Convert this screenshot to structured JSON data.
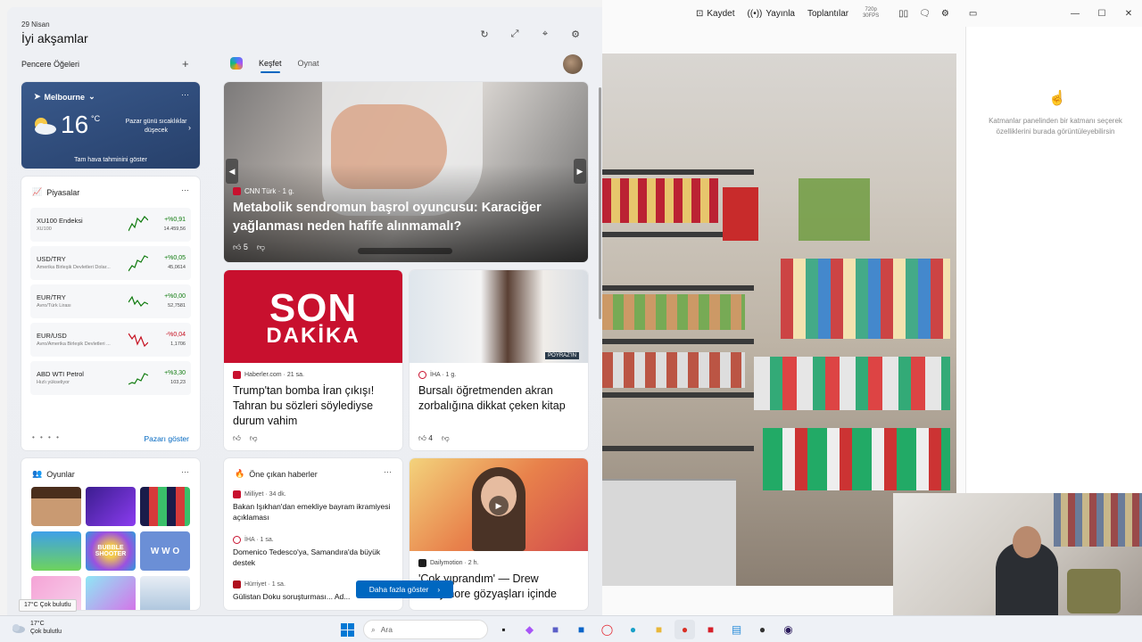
{
  "widgets": {
    "date": "29 Nisan",
    "greeting": "İyi akşamlar",
    "section_label": "Pencere Öğeleri",
    "tabs": [
      "Keşfet",
      "Oynat"
    ]
  },
  "weather": {
    "location": "Melbourne",
    "temperature": "16",
    "unit": "°C",
    "forecast": "Pazar günü sıcaklıklar düşecek",
    "full_link": "Tam hava tahminini göster"
  },
  "markets": {
    "title": "Piyasalar",
    "footer_link": "Pazarı göster",
    "rows": [
      {
        "symbol": "XU100 Endeksi",
        "sub": "XU100",
        "change": "+%0,91",
        "value": "14.459,56",
        "trend": "up"
      },
      {
        "symbol": "USD/TRY",
        "sub": "Amerika Birleşik Devletleri Dolar...",
        "change": "+%0,05",
        "value": "45,0614",
        "trend": "up"
      },
      {
        "symbol": "EUR/TRY",
        "sub": "Avro/Türk Lirası",
        "change": "+%0,00",
        "value": "52,7581",
        "trend": "up"
      },
      {
        "symbol": "EUR/USD",
        "sub": "Avro/Amerika Birleşik Devletleri ...",
        "change": "-%0,04",
        "value": "1,1706",
        "trend": "down"
      },
      {
        "symbol": "ABD WTI Petrol",
        "sub": "Hızlı yükseliyor",
        "change": "+%3,30",
        "value": "103,23",
        "trend": "up"
      }
    ]
  },
  "games": {
    "title": "Oyunlar",
    "tiles": [
      "BUBBLE SHOOTER",
      "W W O"
    ]
  },
  "hero": {
    "source": "CNN Türk · 1 g.",
    "headline": "Metabolik sendromun başrol oyuncusu: Karaciğer yağlanması neden hafife alınmamalı?",
    "likes": "5"
  },
  "news": [
    {
      "image_text_1": "SON",
      "image_text_2": "DAKİKA",
      "source": "Haberler.com · 21 sa.",
      "title": "Trump'tan bomba İran çıkışı! Tahran bu sözleri söylediyse durum vahim"
    },
    {
      "image_caption": "POYRAZ'IN",
      "source": "İHA · 1 g.",
      "title": "Bursalı öğretmenden akran zorbalığına dikkat çeken kitap",
      "likes": "4"
    }
  ],
  "featured": {
    "title": "Öne çıkan haberler",
    "items": [
      {
        "source": "Milliyet · 34 dk.",
        "title": "Bakan Işıkhan'dan emekliye bayram ikramiyesi açıklaması"
      },
      {
        "source": "İHA · 1 sa.",
        "title": "Domenico Tedesco'ya, Samandıra'da büyük destek"
      },
      {
        "source": "Hürriyet · 1 sa.",
        "title": "Gülistan Doku soruşturması... Ad..."
      }
    ]
  },
  "video": {
    "source": "Dailymotion · 2 h.",
    "title": "'Çok yıprandım' — Drew Barrymore gözyaşları içinde"
  },
  "more_button": "Daha fazla göster",
  "obs": {
    "buttons": [
      "Kaydet",
      "Yayınla",
      "Toplantılar"
    ],
    "resolution": "720p 30FPS",
    "panel_hint": "Katmanlar panelinden bir katmanı seçerek özelliklerini burada görüntüleyebilirsin"
  },
  "taskbar": {
    "weather_temp": "17°C",
    "weather_desc": "Çok bulutlu",
    "tooltip": "17°C Çok bulutlu",
    "search_placeholder": "Ara"
  }
}
